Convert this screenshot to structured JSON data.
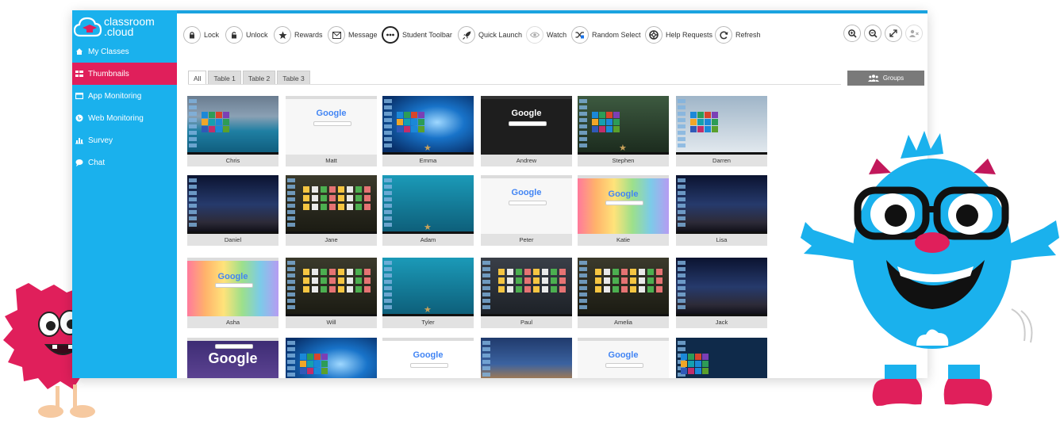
{
  "app": {
    "logo_line1": "classroom",
    "logo_line2": ".cloud",
    "accent": "#1ab1ed",
    "active_color": "#e01f5b"
  },
  "sidebar": {
    "items": [
      {
        "label": "My Classes",
        "icon": "home-icon",
        "active": false
      },
      {
        "label": "Thumbnails",
        "icon": "grid-icon",
        "active": true
      },
      {
        "label": "App Monitoring",
        "icon": "window-icon",
        "active": false
      },
      {
        "label": "Web Monitoring",
        "icon": "globe-icon",
        "active": false
      },
      {
        "label": "Survey",
        "icon": "bar-chart-icon",
        "active": false
      },
      {
        "label": "Chat",
        "icon": "chat-icon",
        "active": false
      }
    ]
  },
  "toolbar": {
    "lock": "Lock",
    "unlock": "Unlock",
    "rewards": "Rewards",
    "message": "Message",
    "student_toolbar": "Student Toolbar",
    "quick_launch": "Quick Launch",
    "watch": "Watch",
    "random_select": "Random Select",
    "help_requests": "Help Requests",
    "refresh": "Refresh"
  },
  "right_tools": [
    "zoom-in-icon",
    "zoom-out-icon",
    "expand-icon",
    "remove-user-icon"
  ],
  "tabs": [
    "All",
    "Table 1",
    "Table 2",
    "Table 3"
  ],
  "groups_button": "Groups",
  "students": [
    {
      "name": "Chris",
      "style": "lake",
      "star": false
    },
    {
      "name": "Matt",
      "style": "google-light",
      "star": false
    },
    {
      "name": "Emma",
      "style": "win10",
      "star": true
    },
    {
      "name": "Andrew",
      "style": "google-dark",
      "star": false
    },
    {
      "name": "Stephen",
      "style": "start-menu",
      "star": true
    },
    {
      "name": "Darren",
      "style": "start-light",
      "star": false
    },
    {
      "name": "Daniel",
      "style": "milky",
      "star": false
    },
    {
      "name": "Jane",
      "style": "apps-dark",
      "star": false
    },
    {
      "name": "Adam",
      "style": "underwater",
      "star": true
    },
    {
      "name": "Peter",
      "style": "google-light",
      "star": false
    },
    {
      "name": "Katie",
      "style": "google-rainbow",
      "star": false
    },
    {
      "name": "Lisa",
      "style": "milky",
      "star": false
    },
    {
      "name": "Asha",
      "style": "google-rainbow",
      "star": false
    },
    {
      "name": "Will",
      "style": "apps-dark",
      "star": false
    },
    {
      "name": "Tyler",
      "style": "underwater",
      "star": true
    },
    {
      "name": "Paul",
      "style": "app-grid",
      "star": false
    },
    {
      "name": "Amelia",
      "style": "apps-dark",
      "star": false
    },
    {
      "name": "Jack",
      "style": "milky",
      "star": false
    },
    {
      "name": "",
      "style": "google-purple",
      "star": false
    },
    {
      "name": "",
      "style": "win10",
      "star": false
    },
    {
      "name": "",
      "style": "google-classic",
      "star": false
    },
    {
      "name": "",
      "style": "harbor",
      "star": false
    },
    {
      "name": "",
      "style": "google-light",
      "star": false
    },
    {
      "name": "",
      "style": "metro",
      "star": false
    }
  ],
  "google_word": "Google"
}
